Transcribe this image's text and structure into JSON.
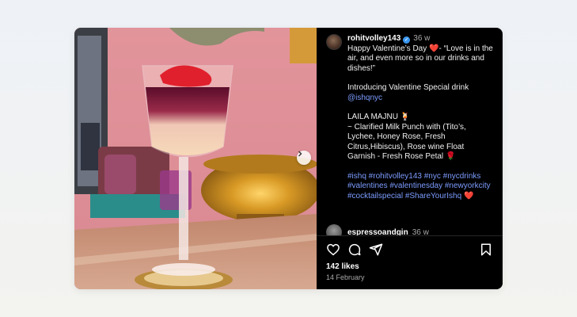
{
  "post": {
    "username": "rohitvolley143",
    "time": "36 w",
    "caption_line1": "Happy Valentine’s Day",
    "caption_line1b": "- “Love is in the air, and even more so in our drinks and dishes!”",
    "intro": "Introducing Valentine Special drink",
    "mention": "@ishqnyc",
    "drink_name": "LAILA MAJNU",
    "drink_desc": "~ Clarified Milk Punch with (Tito’s, Lychee, Honey Rose, Fresh Citrus,Hibiscus), Rose wine Float",
    "garnish": "Garnish - Fresh Rose Petal",
    "hashtags": "#ishq #rohitvolley143 #nyc #nycdrinks #valentines #valentinesday #newyorkcity #cocktailspecial #ShareYourIshq",
    "heart_glyph": "❤️",
    "cocktail_glyph": "🍹",
    "rose_glyph": "🌹"
  },
  "comment": {
    "username": "espressoandgin",
    "time": "36 w"
  },
  "stats": {
    "likes": "142 likes",
    "date": "14 February"
  },
  "colors": {
    "panel_bg": "#000000",
    "hashtag": "#7c9cff",
    "verified": "#3897f0"
  },
  "icons": [
    "heart-icon",
    "comment-icon",
    "share-icon",
    "bookmark-icon",
    "chevron-right-icon"
  ]
}
